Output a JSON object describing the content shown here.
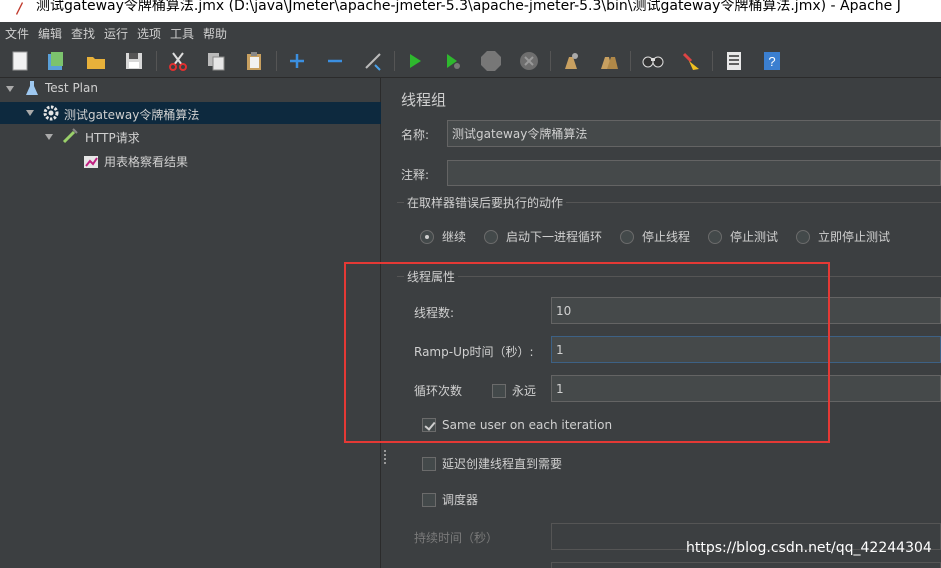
{
  "window": {
    "title": "测试gateway令牌桶算法.jmx (D:\\java\\Jmeter\\apache-jmeter-5.3\\apache-jmeter-5.3\\bin\\测试gateway令牌桶算法.jmx) - Apache J"
  },
  "menu": [
    "文件",
    "编辑",
    "查找",
    "运行",
    "选项",
    "工具",
    "帮助"
  ],
  "toolbar": {
    "icons": [
      "new-icon",
      "templates-icon",
      "open-icon",
      "save-icon",
      "cut-icon",
      "copy-icon",
      "paste-icon",
      "expand-icon",
      "collapse-icon",
      "toggle-icon",
      "start-icon",
      "start-no-pauses-icon",
      "stop-icon",
      "shutdown-icon",
      "clear-icon",
      "clear-all-icon",
      "search-icon",
      "reset-search-icon",
      "function-helper-icon",
      "help-icon"
    ]
  },
  "tree": {
    "items": [
      {
        "label": "Test Plan",
        "icon": "test-plan-icon"
      },
      {
        "label": "测试gateway令牌桶算法",
        "icon": "thread-group-gear-icon"
      },
      {
        "label": "HTTP请求",
        "icon": "http-sampler-icon"
      },
      {
        "label": "用表格察看结果",
        "icon": "table-results-icon"
      }
    ]
  },
  "panel": {
    "heading": "线程组",
    "name_label": "名称:",
    "name_value": "测试gateway令牌桶算法",
    "comment_label": "注释:",
    "comment_value": "",
    "error_group_title": "在取样器错误后要执行的动作",
    "error_actions": [
      {
        "label": "继续",
        "selected": true
      },
      {
        "label": "启动下一进程循环",
        "selected": false
      },
      {
        "label": "停止线程",
        "selected": false
      },
      {
        "label": "停止测试",
        "selected": false
      },
      {
        "label": "立即停止测试",
        "selected": false
      }
    ],
    "thread_props_title": "线程属性",
    "threads_label": "线程数:",
    "threads_value": "10",
    "rampup_label": "Ramp-Up时间（秒）:",
    "rampup_value": "1",
    "loop_label": "循环次数",
    "forever_label": "永远",
    "forever_checked": false,
    "loop_value": "1",
    "same_user_label": "Same user on each iteration",
    "same_user_checked": true,
    "delay_label": "延迟创建线程直到需要",
    "delay_checked": false,
    "scheduler_label": "调度器",
    "scheduler_checked": false,
    "duration_label": "持续时间（秒）"
  },
  "watermark": "https://blog.csdn.net/qq_42244304",
  "colors": {
    "background": "#3c3f41",
    "field": "#45494a",
    "selection": "#0d293e",
    "highlight_box": "#e53935"
  }
}
